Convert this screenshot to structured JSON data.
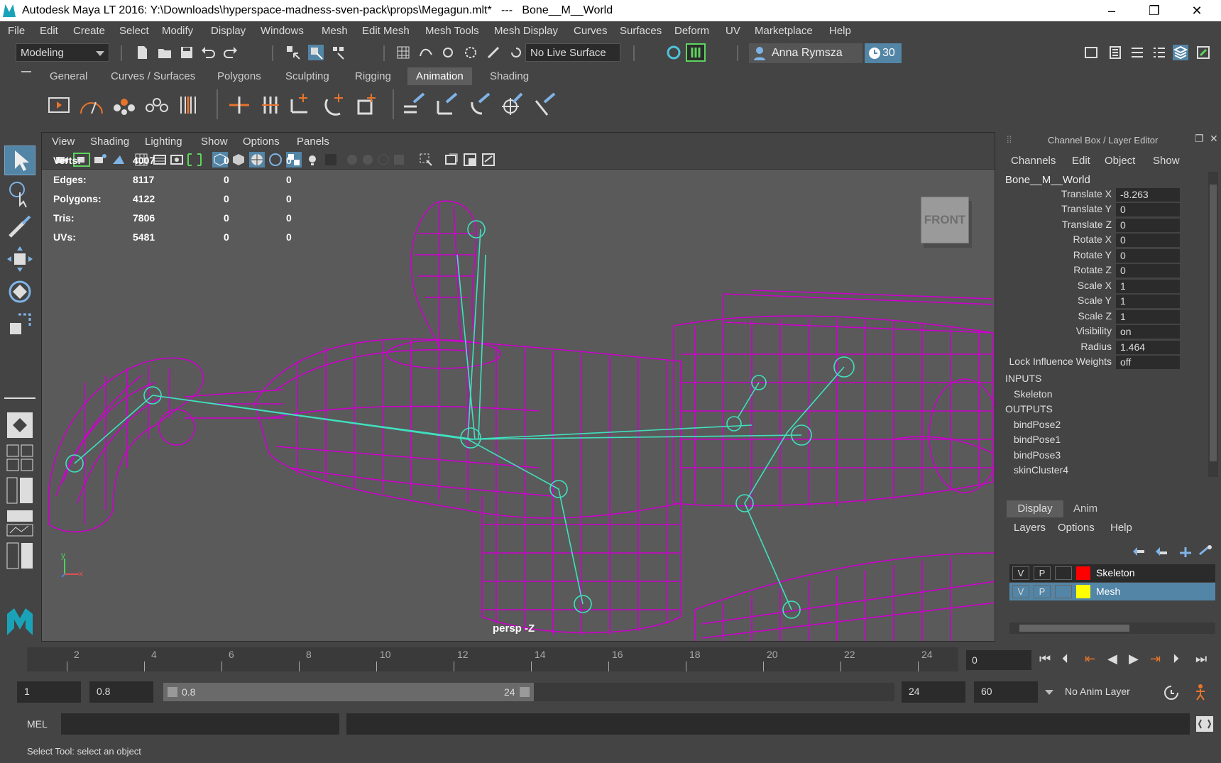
{
  "window": {
    "title": "Autodesk Maya LT 2016: Y:\\Downloads\\hyperspace-madness-sven-pack\\props\\Megagun.mlt*   ---   Bone__M__World",
    "minimize": "–",
    "maximize": "❐",
    "close": "✕"
  },
  "menubar": [
    "File",
    "Edit",
    "Create",
    "Select",
    "Modify",
    "Display",
    "Windows",
    "Mesh",
    "Edit Mesh",
    "Mesh Tools",
    "Mesh Display",
    "Curves",
    "Surfaces",
    "Deform",
    "UV",
    "Marketplace",
    "Help"
  ],
  "statusline": {
    "mode": "Modeling",
    "live_surface": "No Live Surface",
    "user": "Anna Rymsza",
    "days": "30"
  },
  "shelf_tabs": [
    "General",
    "Curves / Surfaces",
    "Polygons",
    "Sculpting",
    "Rigging",
    "Animation",
    "Shading"
  ],
  "active_shelf_tab": "Animation",
  "viewport": {
    "menu": [
      "View",
      "Shading",
      "Lighting",
      "Show",
      "Options",
      "Panels"
    ],
    "hud": [
      {
        "label": "Verts:",
        "v1": "4007",
        "v2": "0",
        "v3": "0"
      },
      {
        "label": "Edges:",
        "v1": "8117",
        "v2": "0",
        "v3": "0"
      },
      {
        "label": "Polygons:",
        "v1": "4122",
        "v2": "0",
        "v3": "0"
      },
      {
        "label": "Tris:",
        "v1": "7806",
        "v2": "0",
        "v3": "0"
      },
      {
        "label": "UVs:",
        "v1": "5481",
        "v2": "0",
        "v3": "0"
      }
    ],
    "viewcube": "FRONT",
    "camera": "persp -Z",
    "axis_y": "y",
    "axis_x": "x",
    "wire_color": "#cc00cc",
    "joint_color": "#40e0c0"
  },
  "channelbox": {
    "title": "Channel Box / Layer Editor",
    "menu": [
      "Channels",
      "Edit",
      "Object",
      "Show"
    ],
    "object": "Bone__M__World",
    "attributes": [
      {
        "name": "Translate X",
        "value": "-8.263"
      },
      {
        "name": "Translate Y",
        "value": "0"
      },
      {
        "name": "Translate Z",
        "value": "0"
      },
      {
        "name": "Rotate X",
        "value": "0"
      },
      {
        "name": "Rotate Y",
        "value": "0"
      },
      {
        "name": "Rotate Z",
        "value": "0"
      },
      {
        "name": "Scale X",
        "value": "1"
      },
      {
        "name": "Scale Y",
        "value": "1"
      },
      {
        "name": "Scale Z",
        "value": "1"
      },
      {
        "name": "Visibility",
        "value": "on"
      },
      {
        "name": "Radius",
        "value": "1.464"
      },
      {
        "name": "Lock Influence Weights",
        "value": "off"
      }
    ],
    "inputs_label": "INPUTS",
    "inputs": [
      "Skeleton"
    ],
    "outputs_label": "OUTPUTS",
    "outputs": [
      "bindPose2",
      "bindPose1",
      "bindPose3",
      "skinCluster4"
    ]
  },
  "layereditor": {
    "tabs": [
      "Display",
      "Anim"
    ],
    "menu": [
      "Layers",
      "Options",
      "Help"
    ],
    "layers": [
      {
        "v": "V",
        "p": "P",
        "name": "Skeleton",
        "color": "#ff0000"
      },
      {
        "v": "V",
        "p": "P",
        "name": "Mesh",
        "color": "#ffff00"
      }
    ]
  },
  "timeslider": {
    "ticks": [
      "2",
      "4",
      "6",
      "8",
      "10",
      "12",
      "14",
      "16",
      "18",
      "20",
      "22",
      "24"
    ],
    "current_frame": "0"
  },
  "rangeslider": {
    "start": "1",
    "playback_start": "0.8",
    "range_start_label": "0.8",
    "range_end_label": "24",
    "playback_end": "24",
    "end": "60",
    "anim_layer": "No Anim Layer"
  },
  "commandline": {
    "label": "MEL"
  },
  "helpline": "Select Tool: select an object"
}
